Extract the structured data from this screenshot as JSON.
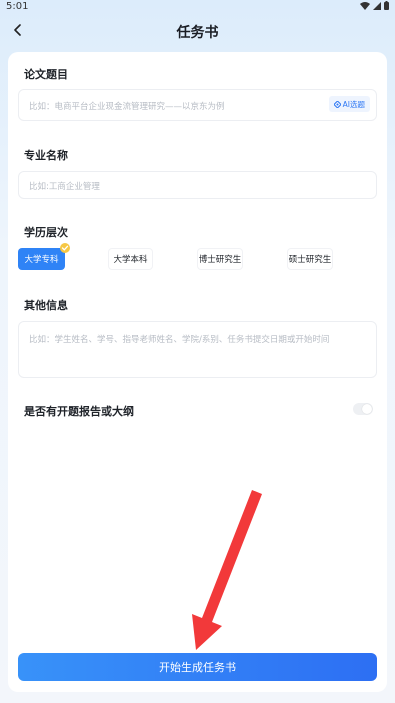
{
  "status_bar": {
    "time": "5:01"
  },
  "header": {
    "title": "任务书"
  },
  "form": {
    "thesis_title": {
      "label": "论文题目",
      "placeholder": "比如：电商平台企业现金流管理研究——以京东为例",
      "ai_button": "AI选题"
    },
    "major": {
      "label": "专业名称",
      "placeholder": "比如:工商企业管理"
    },
    "degree_level": {
      "label": "学历层次",
      "options": [
        "大学专科",
        "大学本科",
        "博士研究生",
        "硕士研究生"
      ],
      "selected": "大学专科"
    },
    "other_info": {
      "label": "其他信息",
      "placeholder": "比如：学生姓名、学号、指导老师姓名、学院/系别、任务书提交日期或开始时间"
    },
    "has_outline": {
      "label": "是否有开题报告或大纲",
      "value": false
    }
  },
  "submit_button": "开始生成任务书",
  "colors": {
    "accent": "#2f83f6",
    "annotation_arrow": "#f2393a"
  }
}
